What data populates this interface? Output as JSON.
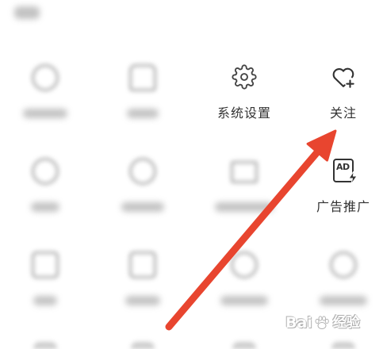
{
  "menu": {
    "settings": {
      "label": "系统设置",
      "icon": "gear-icon"
    },
    "follow": {
      "label": "关注",
      "icon": "heart-plus-icon"
    },
    "ads": {
      "label": "广告推广",
      "icon": "ad-icon",
      "icon_text": "AD"
    }
  },
  "colors": {
    "text": "#333333",
    "icon_stroke": "#444444",
    "arrow": "#e8452f",
    "blurred": "#9c9c9c",
    "background": "#ffffff"
  },
  "watermark": {
    "brand": "Bai",
    "paw_icon": "paw-icon",
    "suffix": "经验"
  }
}
